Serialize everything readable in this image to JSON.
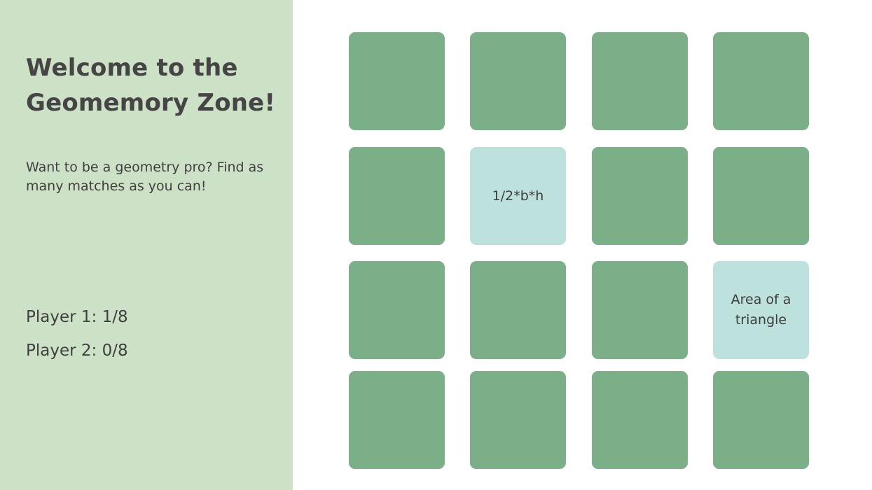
{
  "sidebar": {
    "title": "Welcome to the Geomemory Zone!",
    "intro": "Want to be a geometry pro? Find as many matches as you can!",
    "scores": {
      "player1": "Player 1: 1/8",
      "player2": "Player 2: 0/8"
    }
  },
  "board": {
    "cards": [
      {
        "state": "facedown",
        "text": ""
      },
      {
        "state": "facedown",
        "text": ""
      },
      {
        "state": "facedown",
        "text": ""
      },
      {
        "state": "facedown",
        "text": ""
      },
      {
        "state": "facedown",
        "text": ""
      },
      {
        "state": "faceup",
        "text": "1/2*b*h"
      },
      {
        "state": "facedown",
        "text": ""
      },
      {
        "state": "facedown",
        "text": ""
      },
      {
        "state": "facedown",
        "text": ""
      },
      {
        "state": "facedown",
        "text": ""
      },
      {
        "state": "facedown",
        "text": ""
      },
      {
        "state": "faceup",
        "text": "Area of a triangle"
      },
      {
        "state": "facedown",
        "text": ""
      },
      {
        "state": "facedown",
        "text": ""
      },
      {
        "state": "facedown",
        "text": ""
      },
      {
        "state": "facedown",
        "text": ""
      }
    ]
  },
  "colors": {
    "sidebar_bg": "#cde1c6",
    "card_facedown": "#7aaf87",
    "card_faceup": "#bde2dd",
    "text": "#444444"
  }
}
